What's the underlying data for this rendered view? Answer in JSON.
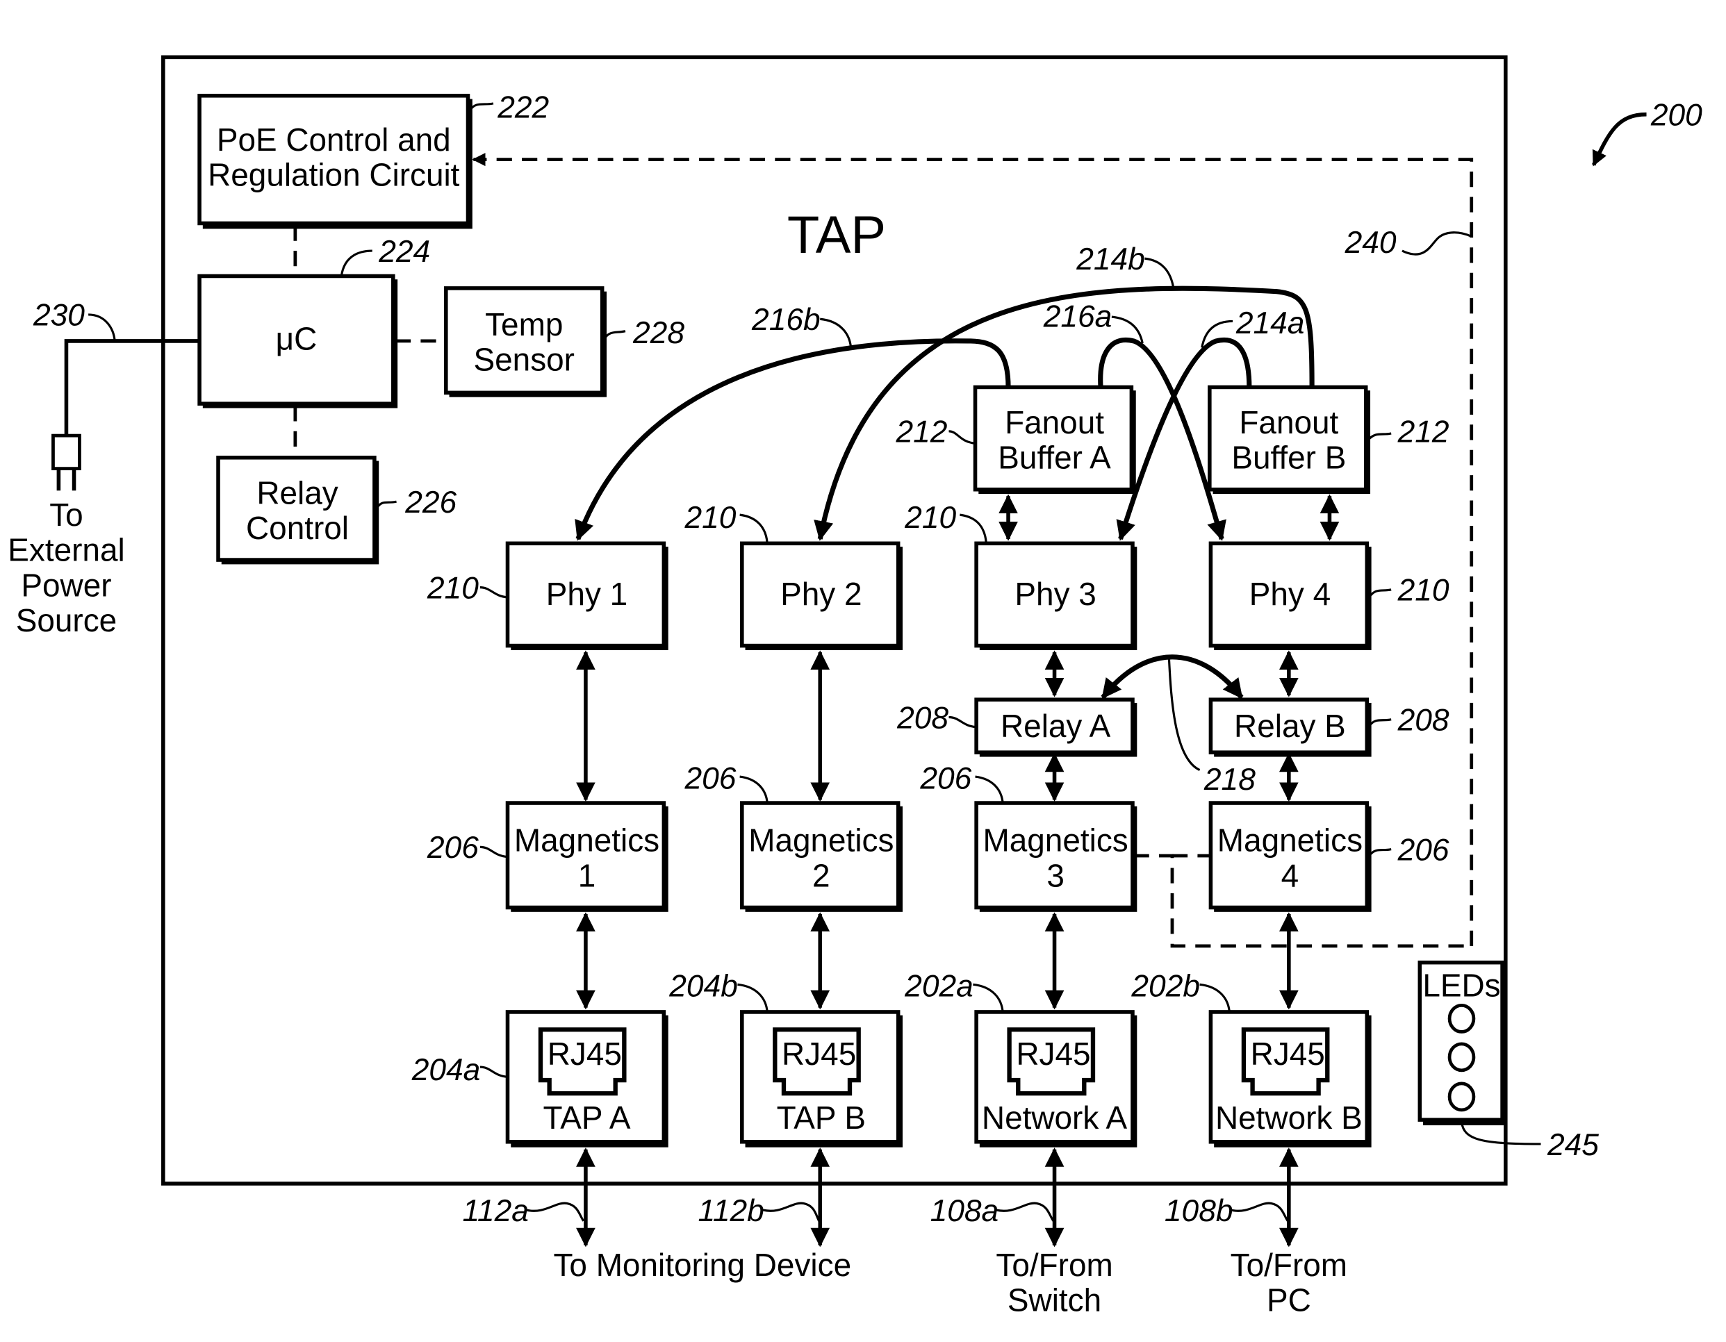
{
  "figure": {
    "ref": "200",
    "title": "TAP"
  },
  "blocks": {
    "poe": {
      "line1": "PoE Control and",
      "line2": "Regulation Circuit",
      "ref": "222"
    },
    "uc": {
      "label": "μC",
      "ref": "224"
    },
    "temp": {
      "line1": "Temp",
      "line2": "Sensor",
      "ref": "228"
    },
    "relay_control": {
      "line1": "Relay",
      "line2": "Control",
      "ref": "226"
    },
    "fanout_a": {
      "line1": "Fanout",
      "line2": "Buffer A",
      "ref": "212"
    },
    "fanout_b": {
      "line1": "Fanout",
      "line2": "Buffer B",
      "ref": "212"
    },
    "phys": [
      {
        "label": "Phy 1",
        "ref": "210"
      },
      {
        "label": "Phy 2",
        "ref": "210"
      },
      {
        "label": "Phy 3",
        "ref": "210"
      },
      {
        "label": "Phy 4",
        "ref": "210"
      }
    ],
    "relays": [
      {
        "label": "Relay A",
        "ref": "208"
      },
      {
        "label": "Relay B",
        "ref": "208"
      }
    ],
    "magnetics": [
      {
        "line1": "Magnetics",
        "line2": "1",
        "ref": "206"
      },
      {
        "line1": "Magnetics",
        "line2": "2",
        "ref": "206"
      },
      {
        "line1": "Magnetics",
        "line2": "3",
        "ref": "206"
      },
      {
        "line1": "Magnetics",
        "line2": "4",
        "ref": "206"
      }
    ],
    "ports": [
      {
        "jack": "RJ45",
        "label": "TAP A",
        "ref": "204a",
        "link_ref": "112a"
      },
      {
        "jack": "RJ45",
        "label": "TAP B",
        "ref": "204b",
        "link_ref": "112b"
      },
      {
        "jack": "RJ45",
        "label": "Network A",
        "ref": "202a",
        "link_ref": "108a"
      },
      {
        "jack": "RJ45",
        "label": "Network B",
        "ref": "202b",
        "link_ref": "108b"
      }
    ],
    "leds": {
      "label": "LEDs",
      "ref": "245",
      "count": 3
    }
  },
  "connections": {
    "power_ref": "230",
    "power_line1": "To",
    "power_line2": "External",
    "power_line3": "Power",
    "power_line4": "Source",
    "poe_path_ref": "240",
    "relay_link_ref": "218",
    "refs_214a": "214a",
    "refs_214b": "214b",
    "refs_216a": "216a",
    "refs_216b": "216b"
  },
  "destinations": {
    "monitoring": "To Monitoring Device",
    "switch_line1": "To/From",
    "switch_line2": "Switch",
    "pc_line1": "To/From",
    "pc_line2": "PC"
  }
}
